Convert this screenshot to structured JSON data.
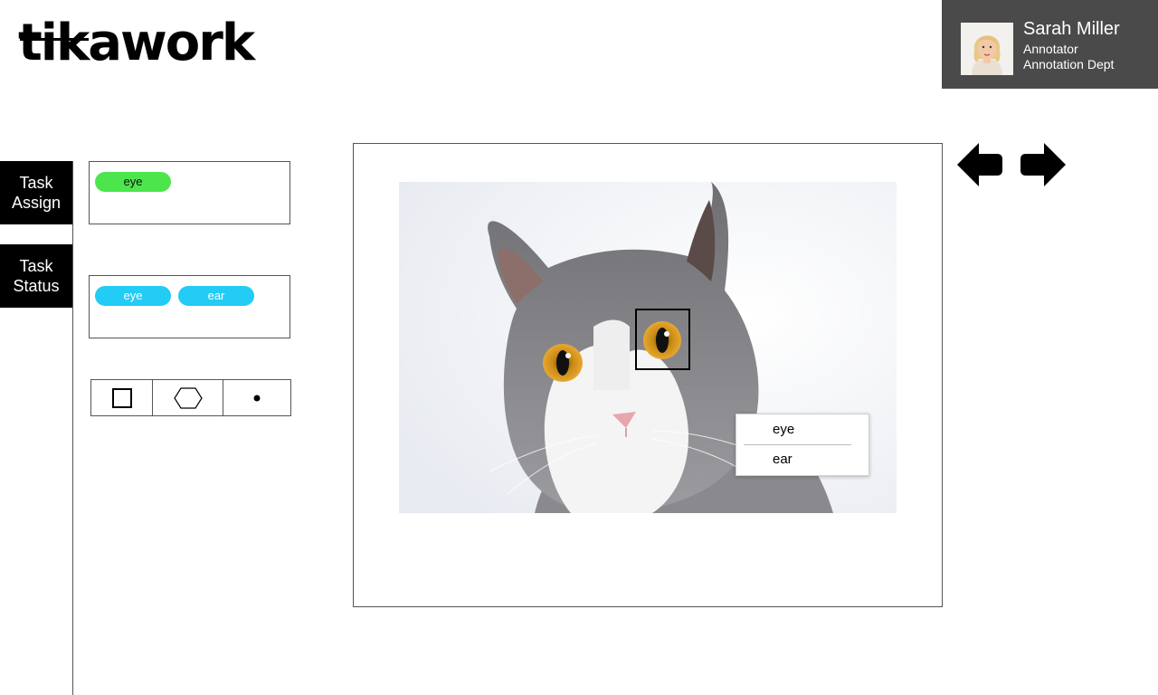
{
  "brand": {
    "logo_text": "tikawork"
  },
  "user": {
    "name": "Sarah Miller",
    "role": "Annotator",
    "department": "Annotation Dept"
  },
  "sidebar": {
    "items": [
      {
        "line1": "Task",
        "line2": "Assign"
      },
      {
        "line1": "Task",
        "line2": "Status"
      }
    ]
  },
  "panels": {
    "selected_labels": [
      {
        "label": "eye",
        "color": "#4ce64c"
      }
    ],
    "available_labels": [
      {
        "label": "eye",
        "color": "#22ccf5"
      },
      {
        "label": "ear",
        "color": "#22ccf5"
      }
    ]
  },
  "tools": [
    "rectangle-icon",
    "polygon-icon",
    "point-icon"
  ],
  "canvas": {
    "label_menu": {
      "items": [
        "eye",
        "ear"
      ]
    }
  },
  "navigation": {
    "prev": "arrow-left-icon",
    "next": "arrow-right-icon"
  }
}
